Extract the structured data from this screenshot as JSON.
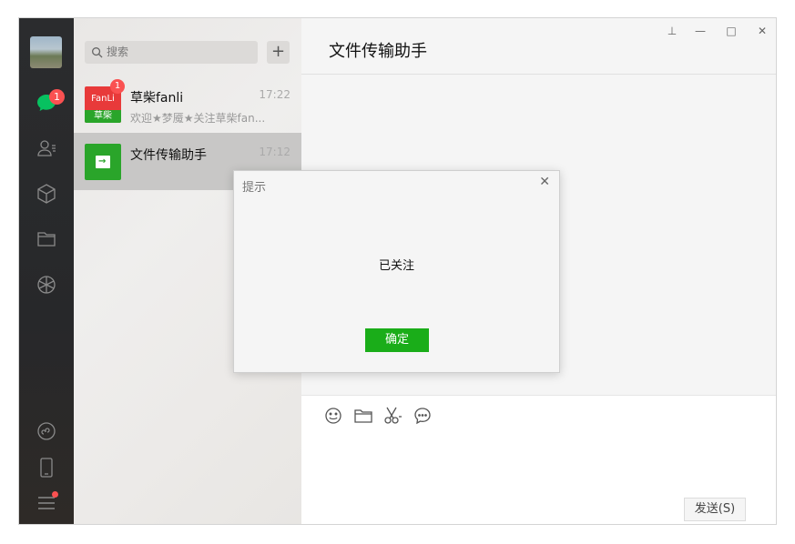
{
  "sidebar": {
    "chat_badge": "1",
    "icons": [
      "chat-icon",
      "contacts-icon",
      "box-icon",
      "folder-icon",
      "moments-icon",
      "mini-program-icon",
      "phone-icon",
      "menu-icon"
    ]
  },
  "list": {
    "search_placeholder": "搜索",
    "add_label": "+",
    "chats": [
      {
        "name": "草柴fanli",
        "time": "17:22",
        "message": "欢迎★梦魇★关注草柴fan...",
        "badge": "1",
        "logo_top": "FanLi",
        "logo_bottom": "草柴"
      },
      {
        "name": "文件传输助手",
        "time": "17:12",
        "message": ""
      }
    ]
  },
  "chat": {
    "title": "文件传输助手",
    "window_controls": {
      "pin": "⊥",
      "minimize": "—",
      "maximize": "□",
      "close": "✕"
    },
    "send_label": "发送(S)"
  },
  "dialog": {
    "title": "提示",
    "message": "已关注",
    "ok_label": "确定",
    "close": "✕"
  },
  "colors": {
    "accent": "#1aad19",
    "badge": "#fa5151",
    "sidebar": "#2b2c2e"
  }
}
